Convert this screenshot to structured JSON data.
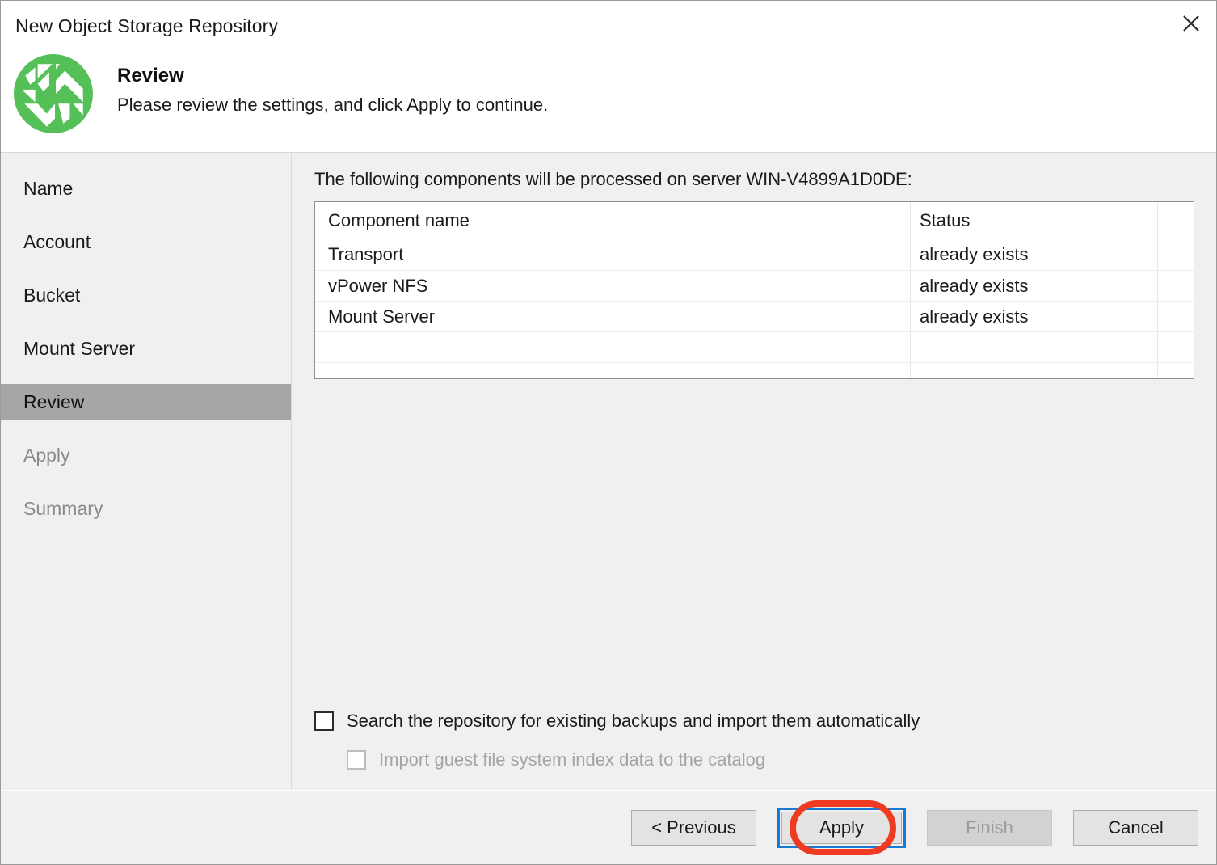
{
  "window": {
    "title": "New Object Storage Repository",
    "close_icon": "close-icon"
  },
  "header": {
    "logo_icon": "veeam-logo-icon",
    "title": "Review",
    "subtitle": "Please review the settings, and click Apply to continue.",
    "accent_color": "#55c057"
  },
  "sidebar": {
    "items": [
      {
        "label": "Name",
        "state": "normal"
      },
      {
        "label": "Account",
        "state": "normal"
      },
      {
        "label": "Bucket",
        "state": "normal"
      },
      {
        "label": "Mount Server",
        "state": "normal"
      },
      {
        "label": "Review",
        "state": "active"
      },
      {
        "label": "Apply",
        "state": "disabled"
      },
      {
        "label": "Summary",
        "state": "disabled"
      }
    ],
    "active_color": "#a6a6a6"
  },
  "main": {
    "intro": "The following components will be processed on server WIN-V4899A1D0DE:",
    "table": {
      "columns": [
        "Component name",
        "Status",
        ""
      ],
      "rows": [
        {
          "name": "Transport",
          "status": "already exists"
        },
        {
          "name": "vPower NFS",
          "status": "already exists"
        },
        {
          "name": "Mount Server",
          "status": "already exists"
        },
        {
          "name": "",
          "status": ""
        },
        {
          "name": "",
          "status": ""
        }
      ]
    },
    "options": [
      {
        "label": "Search the repository for existing backups and import them automatically",
        "checked": false,
        "enabled": true
      },
      {
        "label": "Import guest file system index data to the catalog",
        "checked": false,
        "enabled": false
      }
    ]
  },
  "footer": {
    "previous": "< Previous",
    "apply": "Apply",
    "finish": "Finish",
    "cancel": "Cancel",
    "focus_color": "#1479d7",
    "annotation_color": "#ef3b22"
  }
}
